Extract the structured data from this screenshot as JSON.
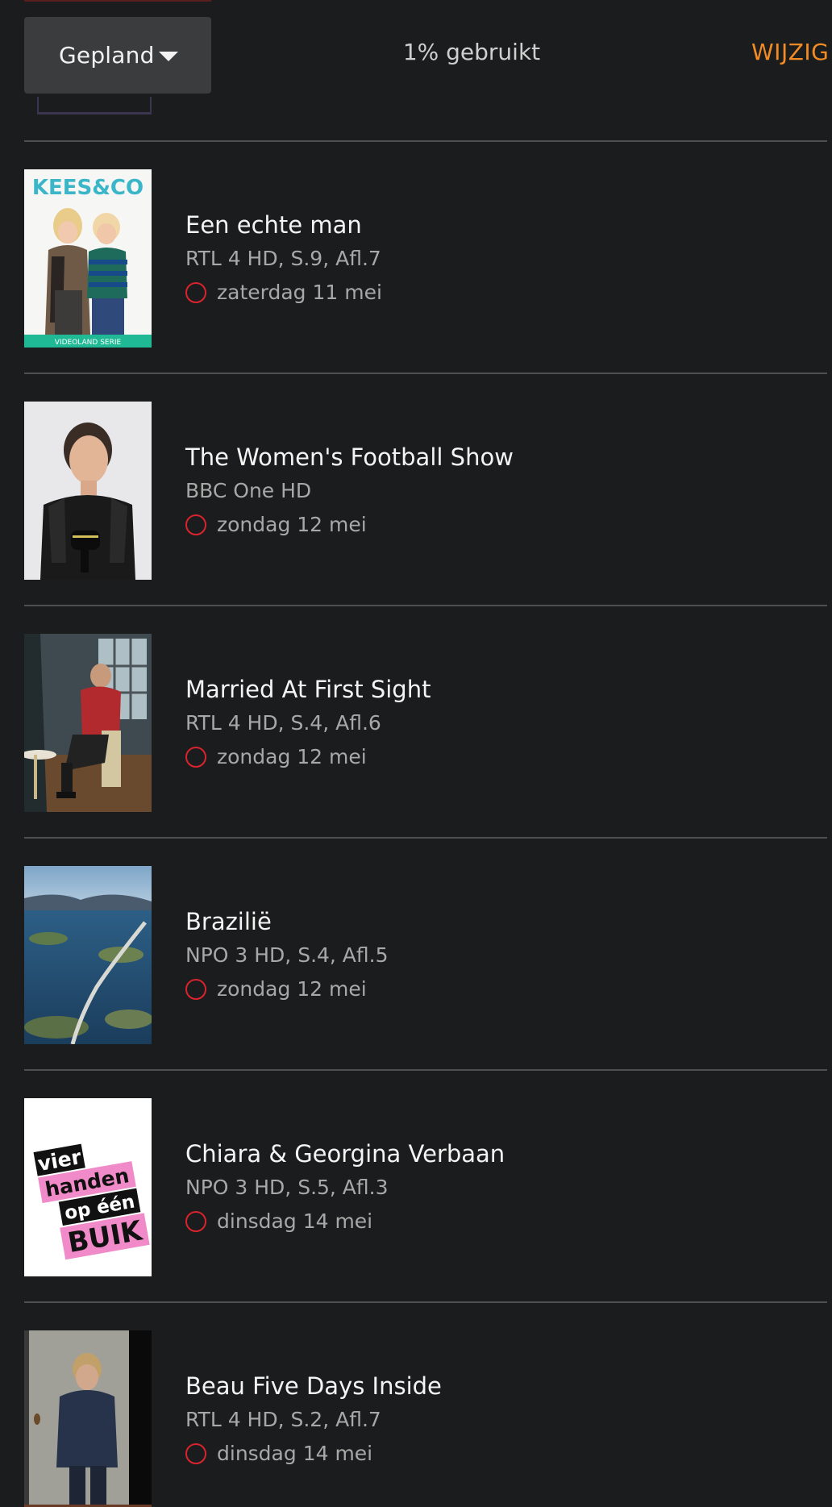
{
  "header": {
    "filter": {
      "label": "Gepland",
      "icon": "chevron-down-icon"
    },
    "usage": "1% gebruikt",
    "edit_label": "WIJZIG",
    "accent_color": "#f28b24"
  },
  "recordings": [
    {
      "title": "Een echte man",
      "subtitle": "RTL 4 HD, S.9, Afl.7",
      "date": "zaterdag 11 mei",
      "thumb": {
        "logo": "KEES&CO",
        "footer": "VIDEOLAND SERIE"
      }
    },
    {
      "title": "The Women's Football Show",
      "subtitle": "BBC One HD",
      "date": "zondag 12 mei"
    },
    {
      "title": "Married At First Sight",
      "subtitle": "RTL 4 HD, S.4, Afl.6",
      "date": "zondag 12 mei"
    },
    {
      "title": "Brazilië",
      "subtitle": "NPO 3 HD, S.4, Afl.5",
      "date": "zondag 12 mei"
    },
    {
      "title": "Chiara & Georgina Verbaan",
      "subtitle": "NPO 3 HD, S.5, Afl.3",
      "date": "dinsdag 14 mei",
      "thumb": {
        "logo_lines": [
          "vier",
          "handen",
          "op één",
          "BUIK"
        ]
      }
    },
    {
      "title": "Beau Five Days Inside",
      "subtitle": "RTL 4 HD, S.2, Afl.7",
      "date": "dinsdag 14 mei"
    }
  ],
  "status_icon": "record-icon",
  "status_color": "#d9232e"
}
